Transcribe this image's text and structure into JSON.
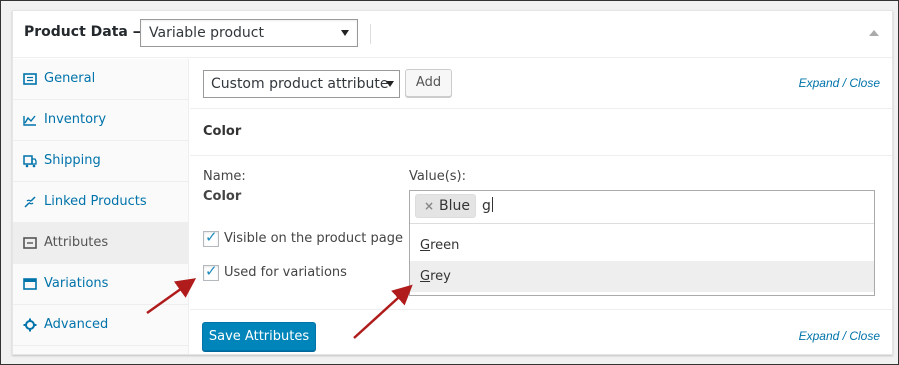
{
  "header": {
    "title": "Product Data —",
    "product_type": "Variable product"
  },
  "tabs": [
    {
      "label": "General",
      "icon": "general-icon",
      "active": false
    },
    {
      "label": "Inventory",
      "icon": "inventory-icon",
      "active": false
    },
    {
      "label": "Shipping",
      "icon": "shipping-icon",
      "active": false
    },
    {
      "label": "Linked Products",
      "icon": "link-icon",
      "active": false
    },
    {
      "label": "Attributes",
      "icon": "attributes-icon",
      "active": true
    },
    {
      "label": "Variations",
      "icon": "variations-icon",
      "active": false
    },
    {
      "label": "Advanced",
      "icon": "gear-icon",
      "active": false
    }
  ],
  "toolbar": {
    "attribute_select": "Custom product attribute",
    "add_label": "Add",
    "expand_label": "Expand",
    "close_label": "Close",
    "separator": " / "
  },
  "attribute": {
    "heading": "Color",
    "name_label": "Name:",
    "name_value": "Color",
    "values_label": "Value(s):",
    "selected_tags": [
      "Blue"
    ],
    "typed_text": "g",
    "options": [
      {
        "first": "G",
        "rest": "reen",
        "highlighted": false
      },
      {
        "first": "G",
        "rest": "rey",
        "highlighted": true
      }
    ],
    "visible_label": "Visible on the product page",
    "visible_checked": true,
    "variations_label": "Used for variations",
    "variations_checked": true
  },
  "footer": {
    "save_label": "Save Attributes",
    "expand_label": "Expand",
    "close_label": "Close"
  },
  "colors": {
    "link": "#0073aa",
    "primary_button": "#0085ba",
    "annotation_arrow": "#b01c1c"
  }
}
